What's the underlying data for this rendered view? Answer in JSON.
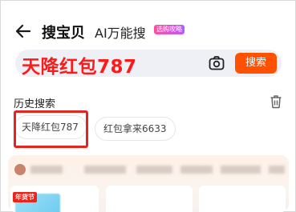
{
  "header": {
    "back_icon": "arrow-left-icon",
    "tab_main_label": "搜宝贝",
    "tab_ai_label": "AI万能搜",
    "tab_ai_badge": "选购攻略"
  },
  "search": {
    "value": "天降红包787",
    "camera_icon": "camera-icon",
    "button_label": "搜索",
    "button_color": "#ff5100",
    "bar_color": "#eef0f6"
  },
  "history": {
    "title": "历史搜索",
    "delete_icon": "trash-icon",
    "items": [
      "天降红包787",
      "红包拿来6633"
    ],
    "highlight_color": "#e2261e"
  },
  "recommend": {
    "tag_label": "年货节",
    "tag_color": "#e8261d"
  }
}
